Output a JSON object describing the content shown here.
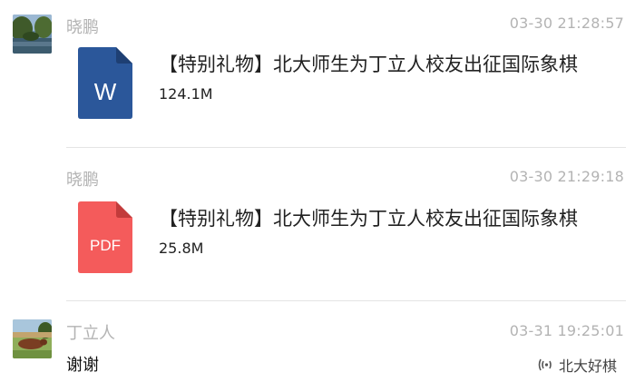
{
  "messages": [
    {
      "sender": "晓鹏",
      "time": "03-30 21:28:57",
      "file": {
        "type": "word",
        "icon_label": "W",
        "name": "【特别礼物】北大师生为丁立人校友出征国际象棋",
        "size": "124.1M",
        "color": "#2b579a"
      }
    },
    {
      "sender": "晓鹏",
      "time": "03-30 21:29:18",
      "file": {
        "type": "pdf",
        "icon_label": "PDF",
        "name": "【特别礼物】北大师生为丁立人校友出征国际象棋",
        "size": "25.8M",
        "color": "#f45b5b"
      }
    },
    {
      "sender": "丁立人",
      "time": "03-31 19:25:01",
      "text": "谢谢"
    }
  ],
  "watermark": {
    "label": "北大好棋",
    "icon": "wechat-channel-icon"
  }
}
